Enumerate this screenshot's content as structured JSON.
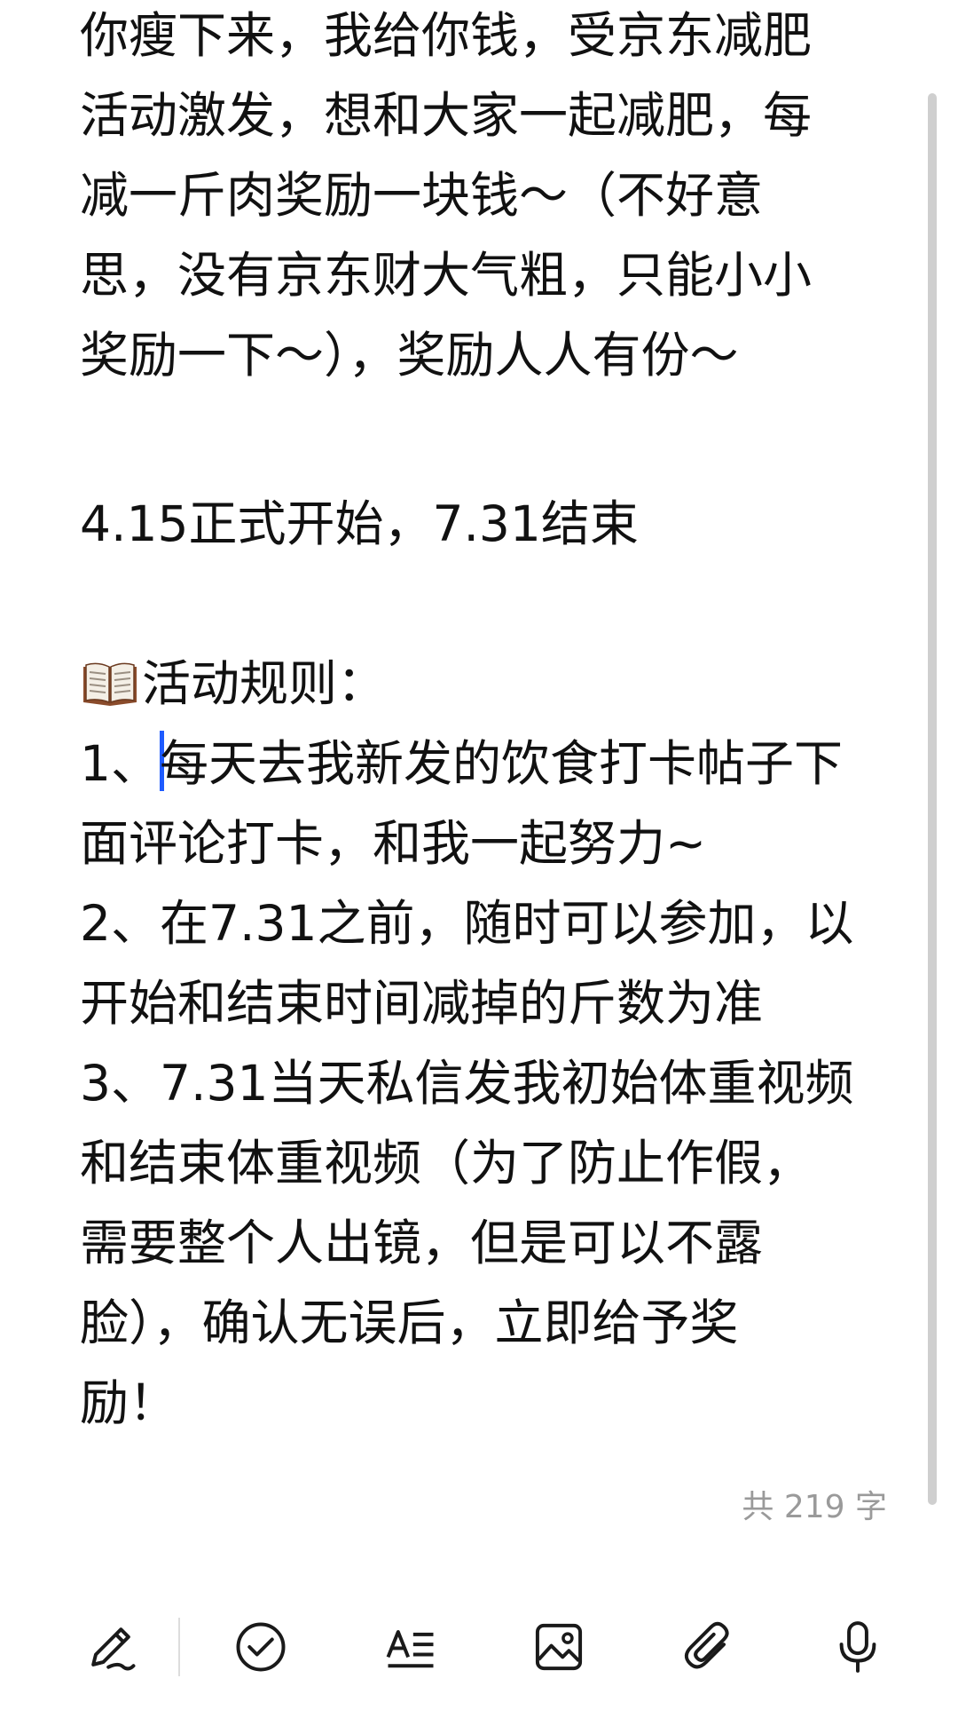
{
  "editor": {
    "intro_lines": [
      "你瘦下来，我给你钱，受京东减肥",
      "活动激发，想和大家一起减肥，每",
      "减一斤肉奖励一块钱～（不好意",
      "思，没有京东财大气粗，只能小小",
      "奖励一下～），奖励人人有份～"
    ],
    "dates_line": "4.15正式开始，7.31结束",
    "rules_heading": "活动规则：",
    "rule1": {
      "prefix": "1、",
      "line1_rest": "每天去我新发的饮食打卡帖子下",
      "line2": "面评论打卡，和我一起努力~"
    },
    "rule2_lines": [
      "2、在7.31之前，随时可以参加，以",
      "开始和结束时间减掉的斤数为准"
    ],
    "rule3_lines": [
      "3、7.31当天私信发我初始体重视频",
      "和结束体重视频（为了防止作假，",
      "需要整个人出镜，但是可以不露",
      "脸），确认无误后，立即给予奖",
      "励！"
    ]
  },
  "word_count": "共 219 字",
  "toolbar": {
    "items": [
      {
        "icon": "pen-icon"
      },
      {
        "icon": "checkbox-icon"
      },
      {
        "icon": "text-format-icon"
      },
      {
        "icon": "image-icon"
      },
      {
        "icon": "attachment-icon"
      },
      {
        "icon": "microphone-icon"
      }
    ]
  },
  "colors": {
    "text": "#111111",
    "caret": "#1e5bff",
    "muted": "#9a9a9a",
    "icon": "#1a1a1a"
  }
}
